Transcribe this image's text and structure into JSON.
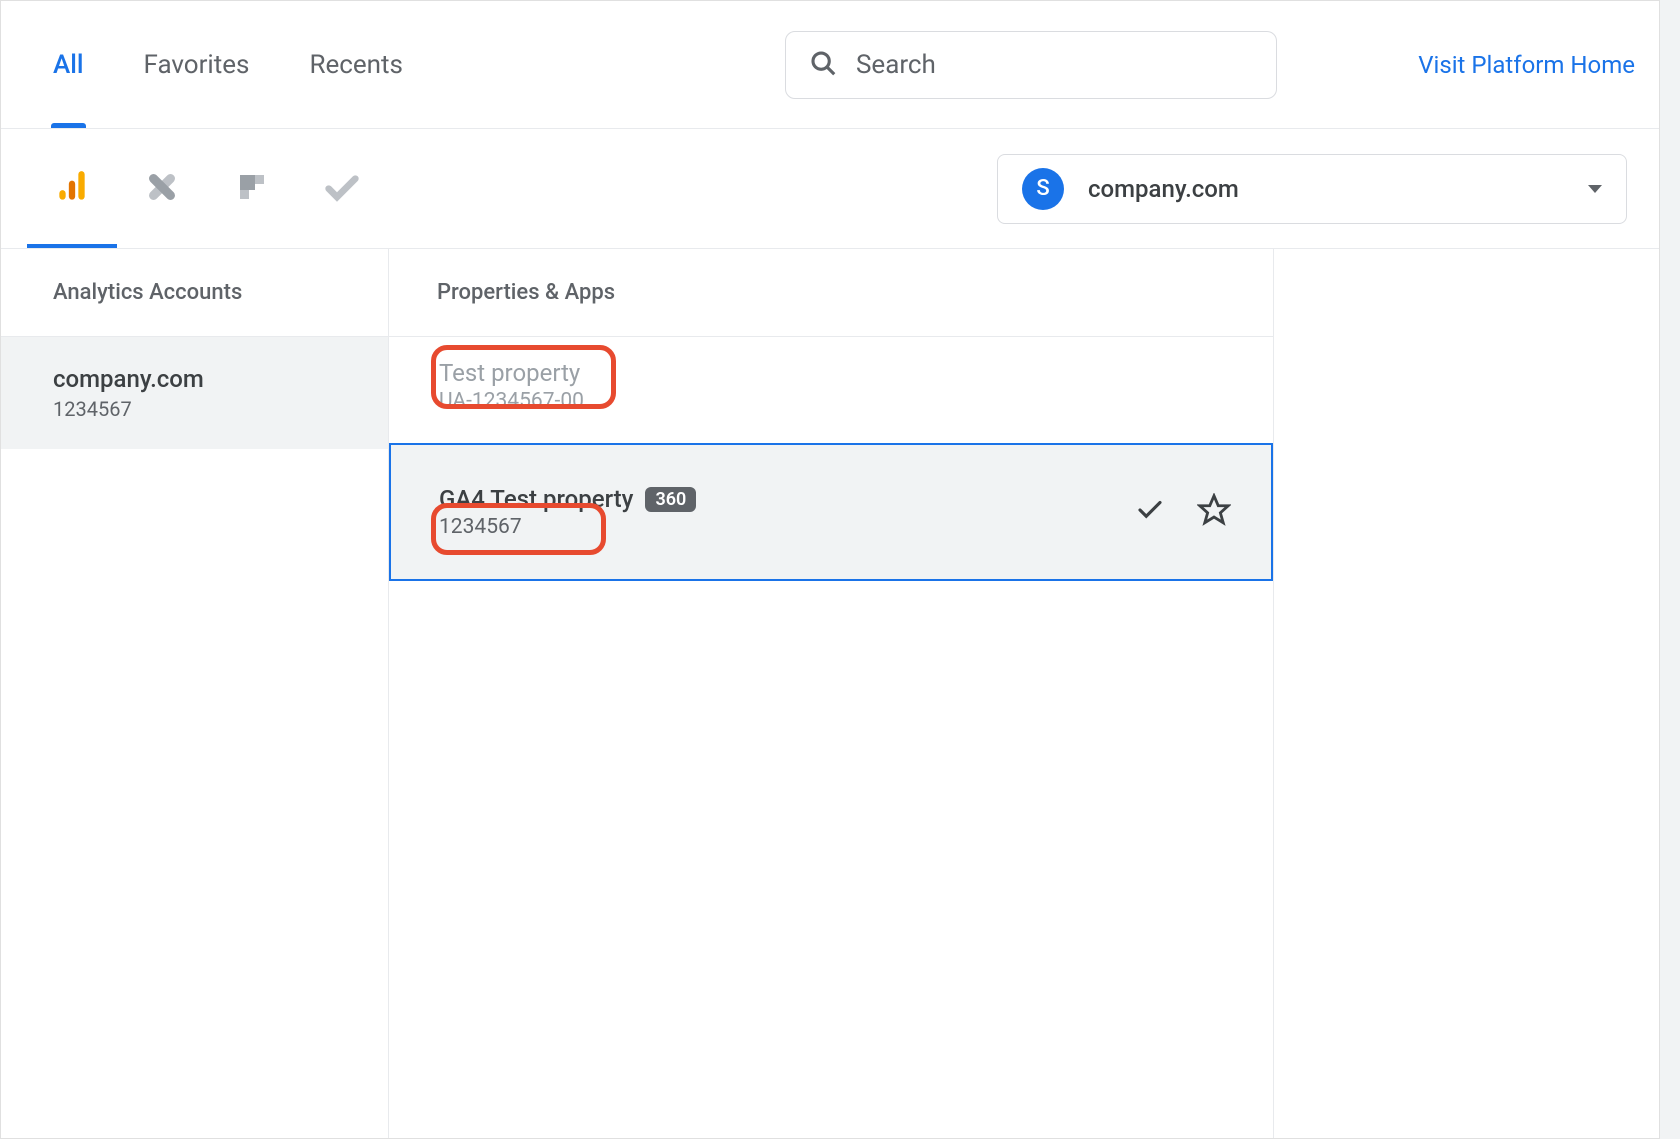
{
  "tabs": {
    "all": "All",
    "favorites": "Favorites",
    "recents": "Recents"
  },
  "search": {
    "placeholder": "Search"
  },
  "link_home": "Visit Platform Home",
  "org": {
    "initial": "S",
    "name": "company.com"
  },
  "columns": {
    "accounts": "Analytics Accounts",
    "properties": "Properties & Apps"
  },
  "account": {
    "name": "company.com",
    "id": "1234567"
  },
  "properties": [
    {
      "name": "Test property",
      "id": "UA-1234567-00"
    },
    {
      "name": "GA4 Test property",
      "id": "1234567",
      "badge": "360"
    }
  ]
}
